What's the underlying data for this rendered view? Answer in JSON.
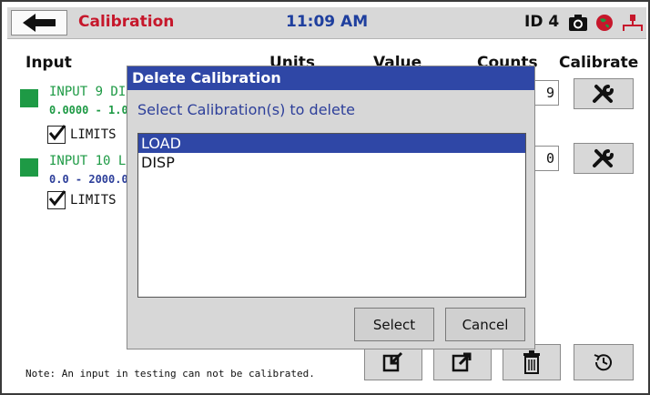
{
  "header": {
    "title": "Calibration",
    "time": "11:09 AM",
    "device_id": "ID 4"
  },
  "columns": {
    "input": "Input",
    "units": "Units",
    "value": "Value",
    "counts": "Counts",
    "calibrate": "Calibrate"
  },
  "inputs": [
    {
      "name": "INPUT 9 DI",
      "range": "0.0000 - 1.0",
      "limits_label": "LIMITS",
      "limits_checked": true,
      "count": "9"
    },
    {
      "name": "INPUT 10 L",
      "range": "0.0 - 2000.0",
      "limits_label": "LIMITS",
      "limits_checked": true,
      "count": "0"
    }
  ],
  "note": "Note: An input in testing can not be calibrated.",
  "dialog": {
    "title": "Delete Calibration",
    "prompt": "Select Calibration(s) to delete",
    "items": [
      {
        "label": "LOAD",
        "selected": true
      },
      {
        "label": "DISP",
        "selected": false
      }
    ],
    "select_label": "Select",
    "cancel_label": "Cancel"
  },
  "icons": {
    "back": "arrow-left-icon",
    "camera": "camera-icon",
    "globe": "globe-icon",
    "network": "network-icon",
    "wrench": "wrench-icon",
    "import": "import-icon",
    "export": "export-icon",
    "trash": "trash-icon",
    "history": "history-icon"
  },
  "colors": {
    "title_red": "#c6172b",
    "time_blue": "#1f3f9e",
    "status_green": "#1e9a45",
    "dialog_blue": "#2f47a6"
  }
}
